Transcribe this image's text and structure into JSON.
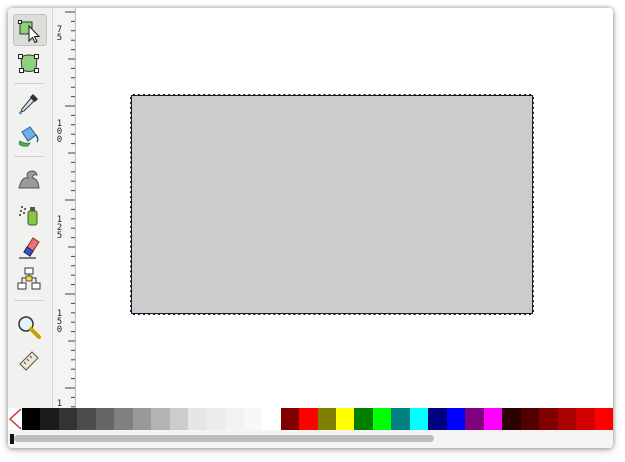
{
  "toolbox": {
    "tools": [
      {
        "name": "select-tool",
        "icon": "arrow-select-icon",
        "active": true
      },
      {
        "name": "node-tool",
        "icon": "node-edit-icon",
        "active": false
      },
      {
        "name": "dropper-tool",
        "icon": "eyedropper-icon",
        "active": false
      },
      {
        "name": "paint-bucket-tool",
        "icon": "paint-bucket-icon",
        "active": false
      },
      {
        "name": "tweak-tool",
        "icon": "tweak-wave-icon",
        "active": false
      },
      {
        "name": "spray-tool",
        "icon": "spray-can-icon",
        "active": false
      },
      {
        "name": "eraser-tool",
        "icon": "eraser-icon",
        "active": false
      },
      {
        "name": "connector-tool",
        "icon": "connector-diagram-icon",
        "active": false
      },
      {
        "name": "zoom-tool",
        "icon": "magnifier-icon",
        "active": false
      },
      {
        "name": "measure-tool",
        "icon": "ruler-measure-icon",
        "active": false
      }
    ]
  },
  "ruler": {
    "labels": [
      {
        "id": "l1",
        "text": "7\n5"
      },
      {
        "id": "l2",
        "text": "1\n0\n0"
      },
      {
        "id": "l3",
        "text": "1\n2\n5"
      },
      {
        "id": "l4",
        "text": "1\n5\n0"
      },
      {
        "id": "l5",
        "text": "1"
      }
    ]
  },
  "canvas": {
    "object": {
      "type": "rectangle",
      "fill": "#cccccc",
      "stroke": "#1a1a2e",
      "selected": true
    }
  },
  "palette": {
    "swatches": [
      "#000000",
      "#1a1a1a",
      "#333333",
      "#4d4d4d",
      "#666666",
      "#808080",
      "#999999",
      "#b3b3b3",
      "#cccccc",
      "#e6e6e6",
      "#ececec",
      "#f2f2f2",
      "#f8f8f8",
      "#ffffff",
      "#800000",
      "#ff0000",
      "#808000",
      "#ffff00",
      "#008000",
      "#00ff00",
      "#008080",
      "#00ffff",
      "#000080",
      "#0000ff",
      "#800080",
      "#ff00ff",
      "#2b0000",
      "#550000",
      "#800000",
      "#aa0000",
      "#d40000",
      "#ff0000"
    ]
  }
}
